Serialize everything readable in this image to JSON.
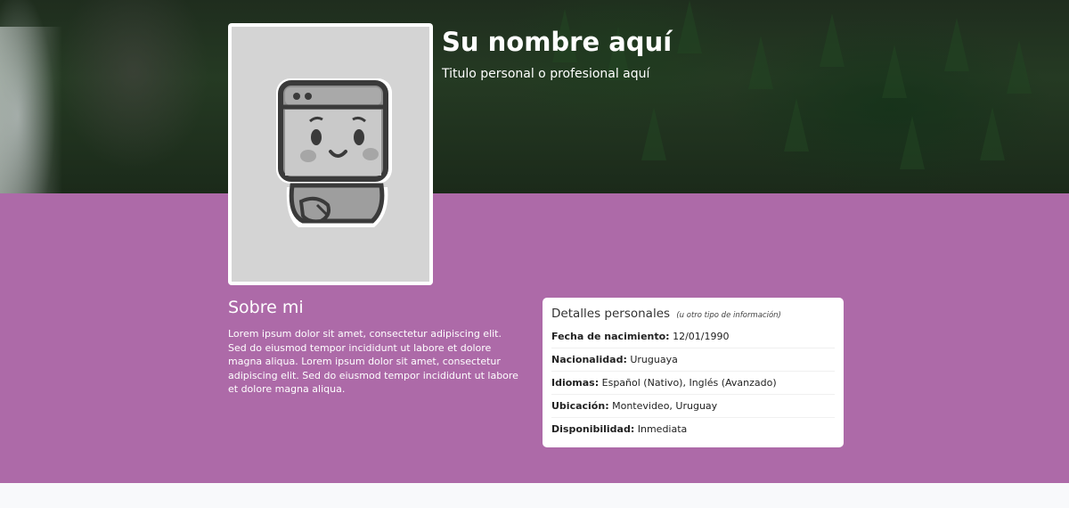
{
  "header": {
    "name": "Su nombre aquí",
    "subtitle": "Titulo personal o profesional aquí"
  },
  "avatar": {
    "icon": "robot-avatar-icon"
  },
  "about": {
    "title": "Sobre mi",
    "text": "Lorem ipsum dolor sit amet, consectetur adipiscing elit. Sed do eiusmod tempor incididunt ut labore et dolore magna aliqua. Lorem ipsum dolor sit amet, consectetur adipiscing elit. Sed do eiusmod tempor incididunt ut labore et dolore magna aliqua."
  },
  "details": {
    "title": "Detalles personales",
    "note": "(u otro tipo de información)",
    "rows": [
      {
        "label": "Fecha de nacimiento:",
        "value": "12/01/1990"
      },
      {
        "label": "Nacionalidad:",
        "value": "Uruguaya"
      },
      {
        "label": "Idiomas:",
        "value": "Español (Nativo), Inglés (Avanzado)"
      },
      {
        "label": "Ubicación:",
        "value": "Montevideo, Uruguay"
      },
      {
        "label": "Disponibilidad:",
        "value": "Inmediata"
      }
    ]
  },
  "colors": {
    "accent": "#ad6aa8",
    "page_bg": "#f8f9fb"
  }
}
